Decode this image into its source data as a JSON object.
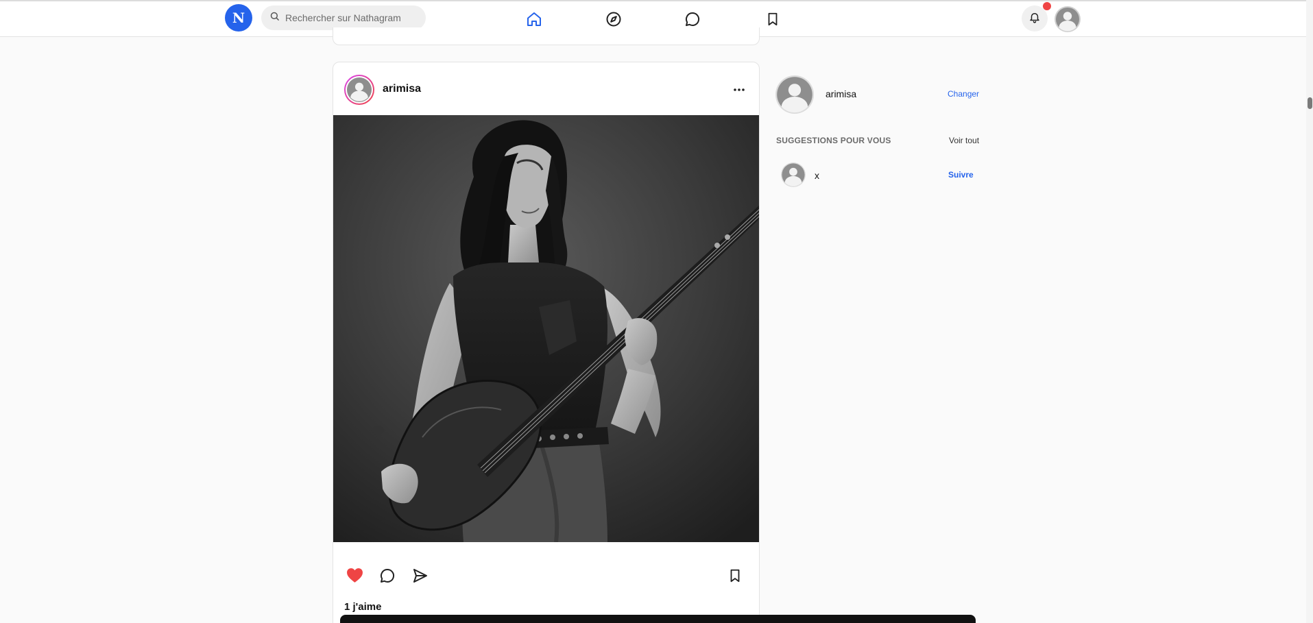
{
  "app": {
    "logo_letter": "N",
    "brand_color": "#2563eb"
  },
  "search": {
    "placeholder": "Rechercher sur Nathagram",
    "icon": "search-icon"
  },
  "nav": {
    "items": [
      {
        "name": "home",
        "icon": "home-icon",
        "active": true
      },
      {
        "name": "explore",
        "icon": "compass-icon",
        "active": false
      },
      {
        "name": "messages",
        "icon": "message-icon",
        "active": false
      },
      {
        "name": "saved",
        "icon": "bookmark-icon",
        "active": false
      }
    ],
    "notifications": {
      "icon": "bell-icon",
      "has_unread": true,
      "dot_color": "#ef4444"
    }
  },
  "post": {
    "username": "arimisa",
    "more_icon": "more-horizontal-icon",
    "image_description_icon": "photo",
    "liked": true,
    "like_color": "#ef4444",
    "likes_label": "1 j'aime"
  },
  "sidebar": {
    "username": "arimisa",
    "switch_label": "Changer",
    "suggestions_title": "SUGGESTIONS POUR VOUS",
    "see_all_label": "Voir tout",
    "suggestions": [
      {
        "username": "x",
        "follow_label": "Suivre"
      }
    ]
  }
}
